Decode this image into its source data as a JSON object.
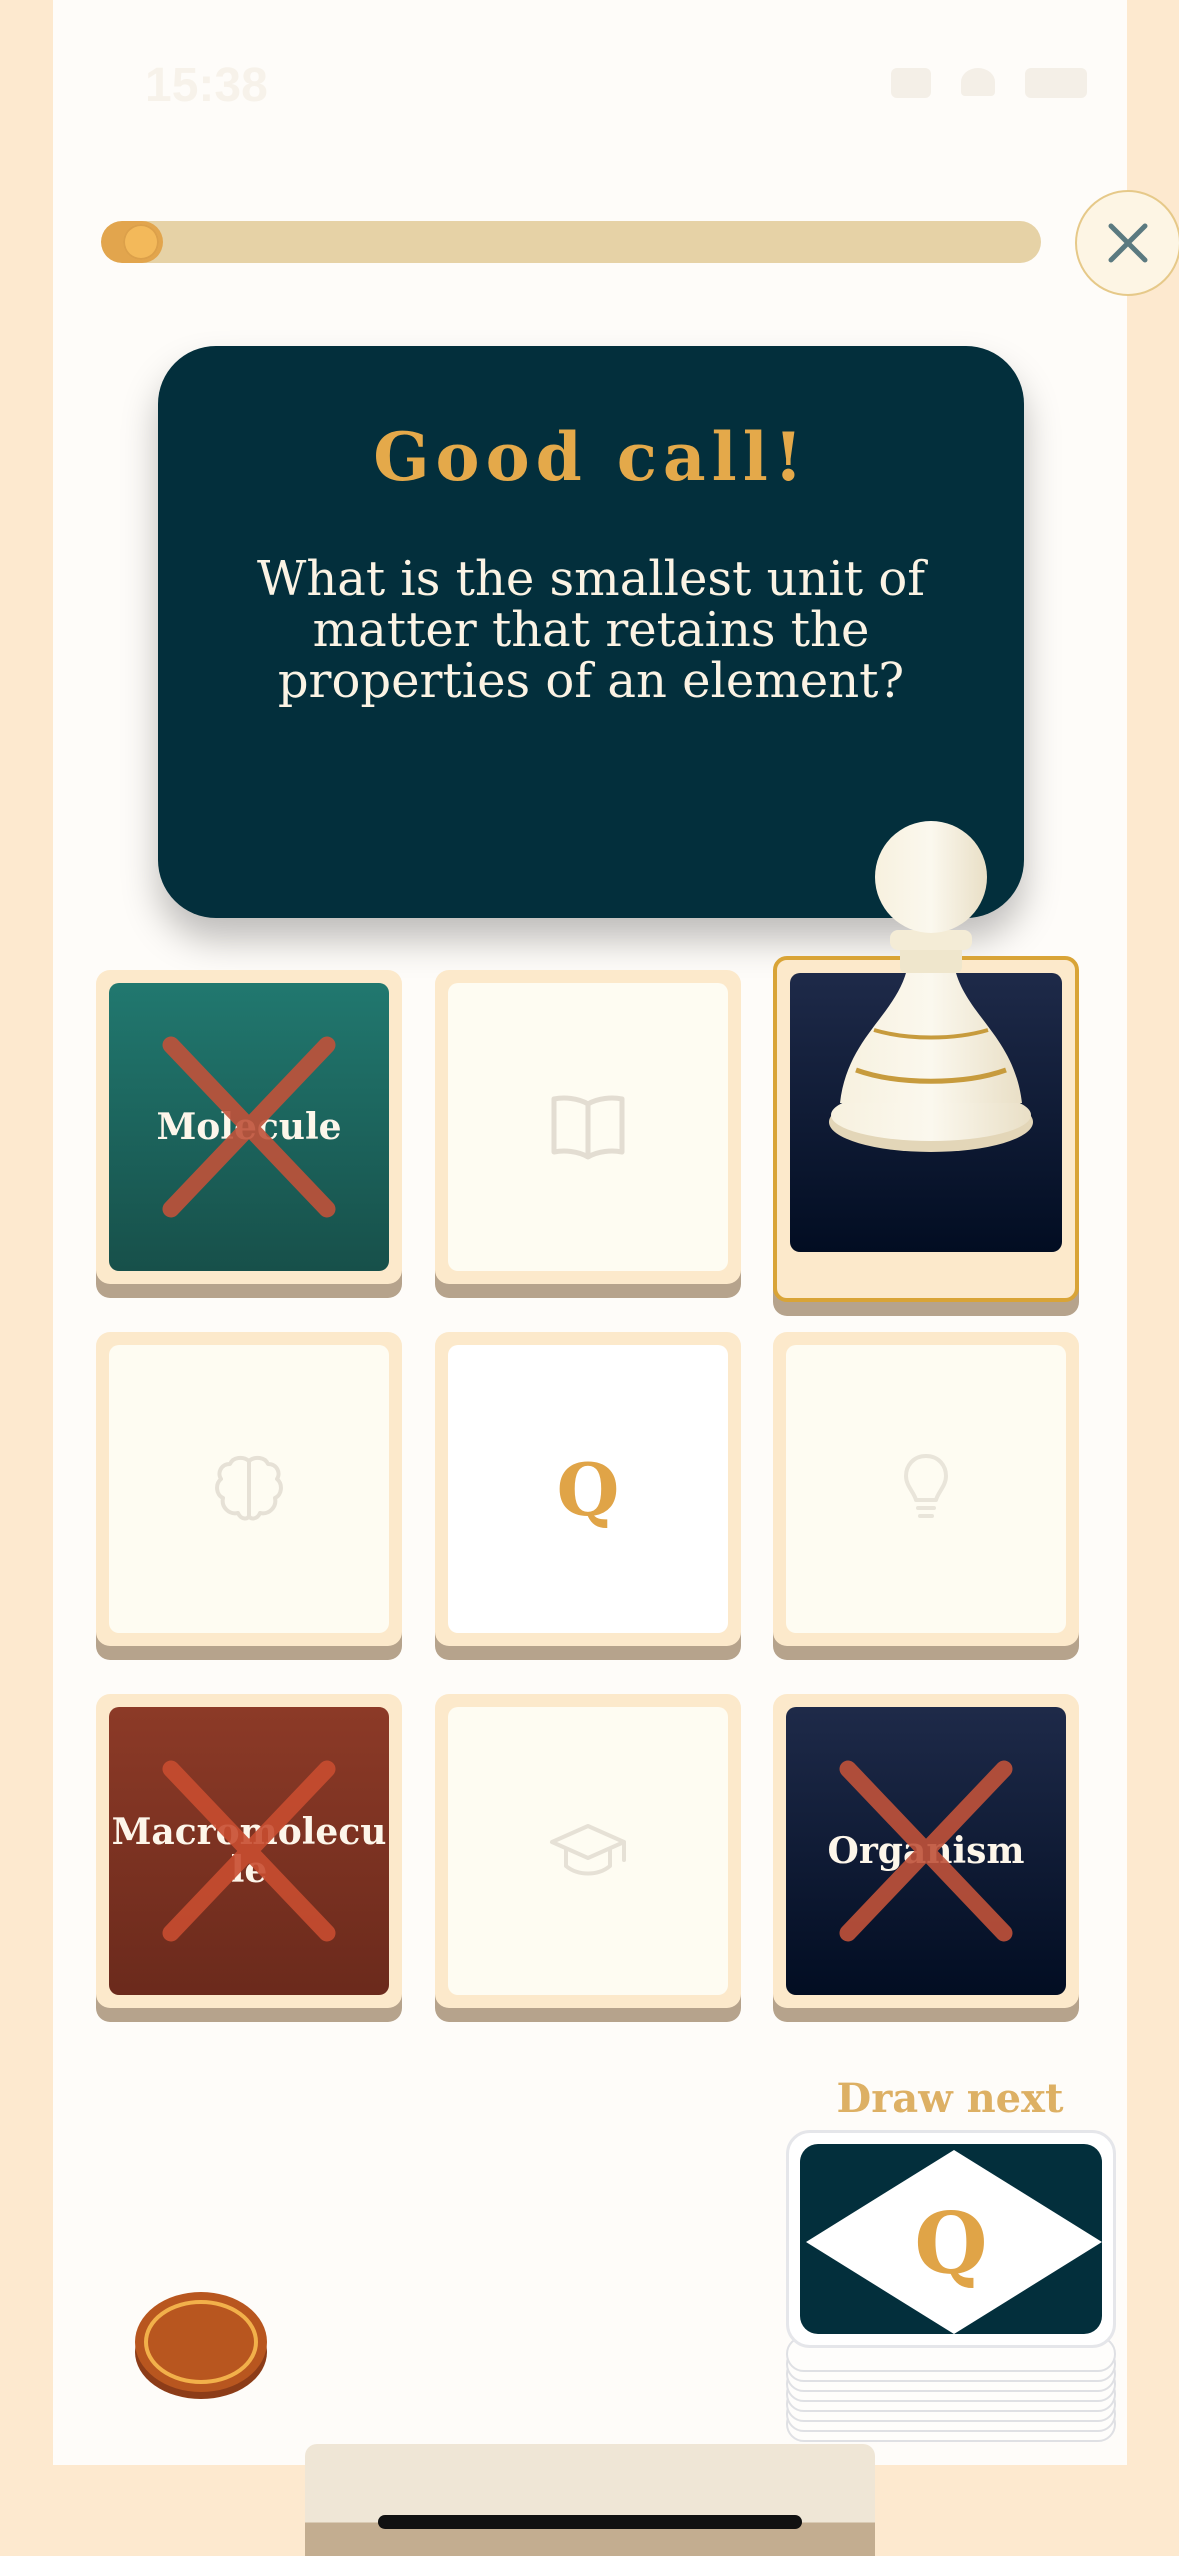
{
  "status_bar": {
    "time": "15:38"
  },
  "progress": {
    "fraction": 0.045
  },
  "close_button": {
    "icon": "close-icon"
  },
  "question_card": {
    "title": "Good call!",
    "question": "What is the smallest unit of matter that retains the properties of an element?"
  },
  "board": {
    "tiles": [
      {
        "label": "Molecule",
        "style": "teal",
        "crossed": true
      },
      {
        "icon": "book-icon",
        "style": "blank"
      },
      {
        "style": "navy",
        "selected": true,
        "piece": "pawn-icon"
      },
      {
        "icon": "brain-icon",
        "style": "blank"
      },
      {
        "label": "Q",
        "style": "blank"
      },
      {
        "icon": "lightbulb-icon",
        "style": "blank"
      },
      {
        "label": "Macromolecule",
        "style": "brown",
        "crossed": true
      },
      {
        "icon": "graduation-cap-icon",
        "style": "blank"
      },
      {
        "label": "Organism",
        "style": "navy",
        "crossed": true
      }
    ]
  },
  "deck": {
    "label": "Draw next",
    "card_letter": "Q"
  },
  "colors": {
    "accent_gold": "#e4a94a",
    "card_dark_teal": "#032f3c",
    "cross_red": "#c0523a"
  }
}
